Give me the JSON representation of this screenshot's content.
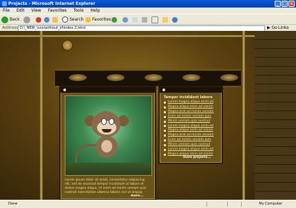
{
  "window": {
    "title": "Projects - Microsoft Internet Explorer"
  },
  "menu": [
    "File",
    "Edit",
    "View",
    "Favorites",
    "Tools",
    "Help"
  ],
  "toolbar": {
    "back_label": "Back",
    "search_label": "Search",
    "favorites_label": "Favorites"
  },
  "address": {
    "label": "Address",
    "value": "D:\\_NEW_\\xxx\\without_sf\\index-3.html",
    "go_label": "Go",
    "links_label": "Links"
  },
  "page": {
    "blurb": "Lorem ipsum dolor sit amet, consectetur adipiscing elit, sed do eiusmod tempor incididunt ut labore et dolore magna aliqua. Ut enim ad minim veniam quis nostrud exercitation ullamco laboris nisi ut aliquip.",
    "left_more": "more...",
    "right_title": "Tempor incididunt labore",
    "project_links": [
      "Lorem magna aliqua enim ad",
      "Magna aliqua enim ad minim",
      "Magna erat ad minim veniam",
      "Enim ad minim veniam quis",
      "Minim veniam quis nostrud",
      "Lorem magna aliqua enim ad",
      "Magna aliqua enim ad minim",
      "Magna erat ad minim veniam",
      "Enim ad minim veniam quis",
      "Minim veniam quis nostrud",
      "Lorem magna aliqua enim ad",
      "Magna aliqua enim ad minim"
    ],
    "right_more": "more projects..."
  },
  "status": {
    "left": "Done",
    "zone": "My Computer"
  },
  "colors": {
    "titlebar": "#0a5ad8",
    "page_bg": "#5c4210",
    "panel": "#6a5418",
    "link": "#f0e0a0"
  }
}
